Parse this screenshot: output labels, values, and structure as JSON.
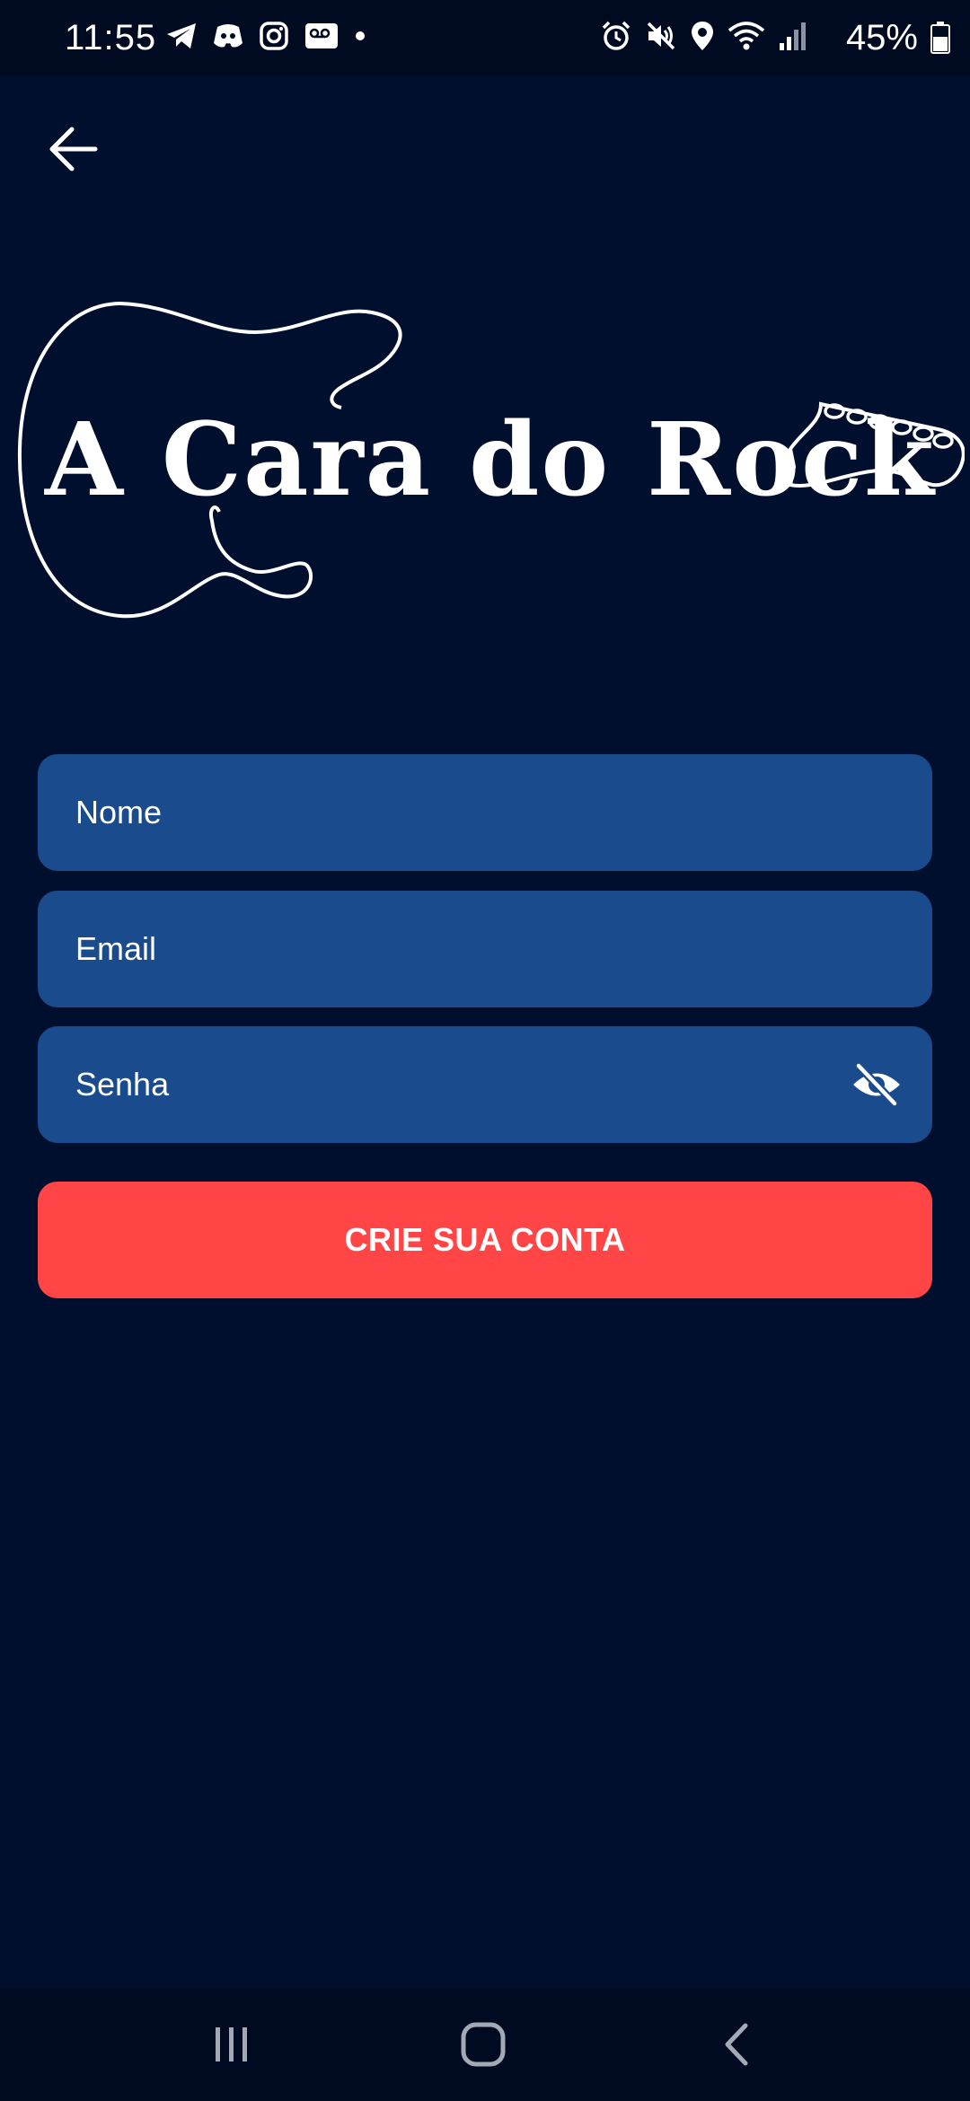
{
  "status_bar": {
    "time": "11:55",
    "battery": "45%",
    "left_icons": [
      "telegram-icon",
      "discord-icon",
      "instagram-icon",
      "voicemail-icon",
      "dot-icon"
    ],
    "right_icons": [
      "alarm-icon",
      "mute-icon",
      "location-icon",
      "wifi-icon",
      "signal-icon",
      "battery-icon"
    ]
  },
  "logo": {
    "text": "A Cara do Rock"
  },
  "form": {
    "name_placeholder": "Nome",
    "email_placeholder": "Email",
    "password_placeholder": "Senha",
    "submit_label": "CRIE SUA CONTA"
  },
  "colors": {
    "background": "#000f2e",
    "field": "#1a4b8c",
    "button": "#ff4545",
    "text": "#ffffff"
  }
}
